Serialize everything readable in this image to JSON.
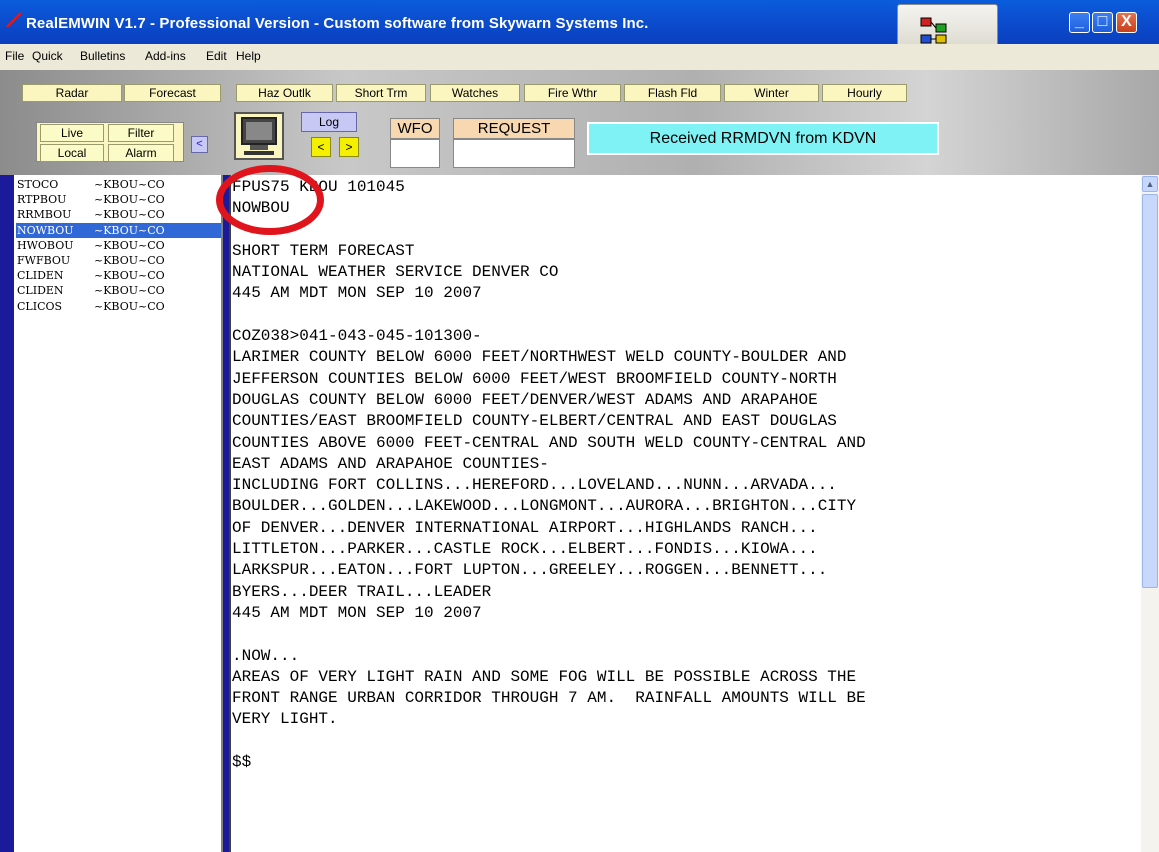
{
  "window": {
    "title": "RealEMWIN V1.7 - Professional Version - Custom software from Skywarn Systems Inc.",
    "controls": {
      "minimize": "_",
      "maximize": "□",
      "close": "X"
    }
  },
  "menu": [
    "File",
    "Quick",
    "Bulletins",
    "Add-ins",
    "Edit",
    "Help"
  ],
  "toolbar": {
    "row1": [
      "Radar",
      "Forecast",
      "Haz Outlk",
      "Short Trm",
      "Watches",
      "Fire Wthr",
      "Flash Fld",
      "Winter",
      "Hourly"
    ],
    "live_label": "Live",
    "filter_label": "Filter",
    "local_label": "Local",
    "alarm_label": "Alarm",
    "small_arrow": "<",
    "log_label": "Log",
    "left_arrow": "<",
    "right_arrow": ">",
    "wfo_label": "WFO",
    "request_label": "REQUEST",
    "status_text": "Received RRMDVN from KDVN"
  },
  "bulletins": [
    {
      "id": "STOCO",
      "source": "~KBOU~CO",
      "selected": false
    },
    {
      "id": "RTPBOU",
      "source": "~KBOU~CO",
      "selected": false
    },
    {
      "id": "RRMBOU",
      "source": "~KBOU~CO",
      "selected": false
    },
    {
      "id": "NOWBOU",
      "source": "~KBOU~CO",
      "selected": true
    },
    {
      "id": "HWOBOU",
      "source": "~KBOU~CO",
      "selected": false
    },
    {
      "id": "FWFBOU",
      "source": "~KBOU~CO",
      "selected": false
    },
    {
      "id": "CLIDEN",
      "source": "~KBOU~CO",
      "selected": false
    },
    {
      "id": "CLIDEN",
      "source": "~KBOU~CO",
      "selected": false
    },
    {
      "id": "CLICOS",
      "source": "~KBOU~CO",
      "selected": false
    }
  ],
  "bulletin_text": "FPUS75 KBOU 101045\nNOWBOU\n\nSHORT TERM FORECAST\nNATIONAL WEATHER SERVICE DENVER CO\n445 AM MDT MON SEP 10 2007\n\nCOZ038>041-043-045-101300-\nLARIMER COUNTY BELOW 6000 FEET/NORTHWEST WELD COUNTY-BOULDER AND\nJEFFERSON COUNTIES BELOW 6000 FEET/WEST BROOMFIELD COUNTY-NORTH\nDOUGLAS COUNTY BELOW 6000 FEET/DENVER/WEST ADAMS AND ARAPAHOE\nCOUNTIES/EAST BROOMFIELD COUNTY-ELBERT/CENTRAL AND EAST DOUGLAS\nCOUNTIES ABOVE 6000 FEET-CENTRAL AND SOUTH WELD COUNTY-CENTRAL AND\nEAST ADAMS AND ARAPAHOE COUNTIES-\nINCLUDING FORT COLLINS...HEREFORD...LOVELAND...NUNN...ARVADA...\nBOULDER...GOLDEN...LAKEWOOD...LONGMONT...AURORA...BRIGHTON...CITY\nOF DENVER...DENVER INTERNATIONAL AIRPORT...HIGHLANDS RANCH...\nLITTLETON...PARKER...CASTLE ROCK...ELBERT...FONDIS...KIOWA...\nLARKSPUR...EATON...FORT LUPTON...GREELEY...ROGGEN...BENNETT...\nBYERS...DEER TRAIL...LEADER\n445 AM MDT MON SEP 10 2007\n\n.NOW...\nAREAS OF VERY LIGHT RAIN AND SOME FOG WILL BE POSSIBLE ACROSS THE\nFRONT RANGE URBAN CORRIDOR THROUGH 7 AM.  RAINFALL AMOUNTS WILL BE\nVERY LIGHT.\n\n$$",
  "colors": {
    "title_bar": "#0b4fd0",
    "status_box": "#7ef2f4",
    "selected_row": "#3168d8",
    "highlight_circle": "#e0141c"
  }
}
